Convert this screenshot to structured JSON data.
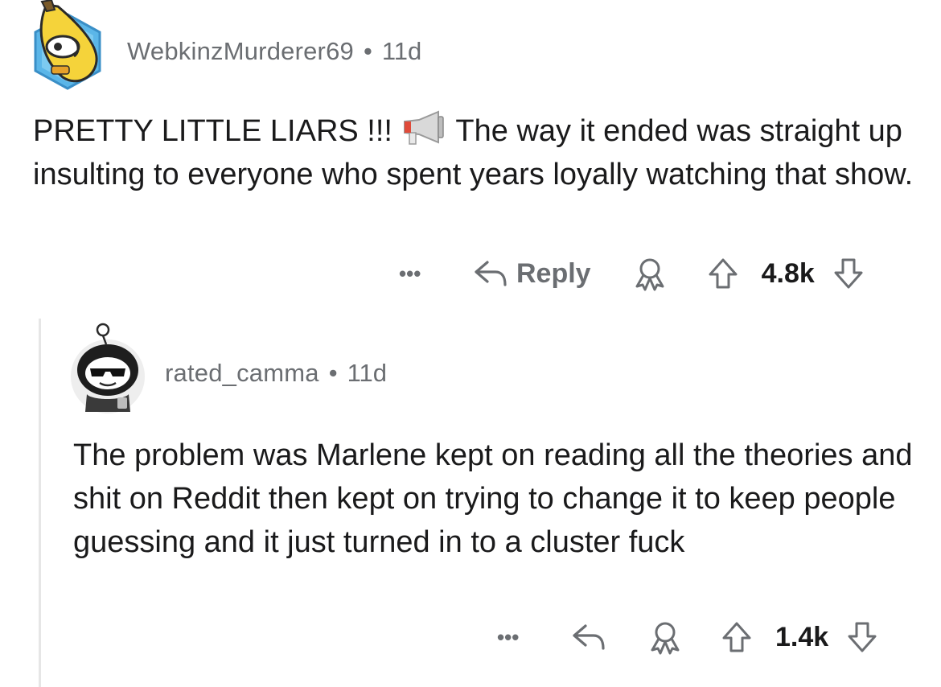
{
  "comments": [
    {
      "username": "WebkinzMurderer69",
      "separator": "•",
      "age": "11d",
      "text_before_emoji": "PRETTY LITTLE LIARS !!! ",
      "emoji": "megaphone",
      "text_after_emoji": " The way it ended was straight up insulting to everyone who spent years loyally watching that show.",
      "more_label": "•••",
      "reply_label": "Reply",
      "score": "4.8k"
    },
    {
      "username": "rated_camma",
      "separator": "•",
      "age": "11d",
      "text": "The problem was Marlene kept on reading all the theories and shit on Reddit then kept on trying to change it to keep people guessing and it just turned in to a cluster fuck",
      "more_label": "•••",
      "score": "1.4k"
    }
  ],
  "icons": {
    "reply": "reply-arrow-icon",
    "award": "award-icon",
    "upvote": "upvote-arrow-icon",
    "downvote": "downvote-arrow-icon"
  },
  "colors": {
    "text": "#1a1a1b",
    "meta": "#6b6e72",
    "thread_line": "#e6e6e6"
  }
}
